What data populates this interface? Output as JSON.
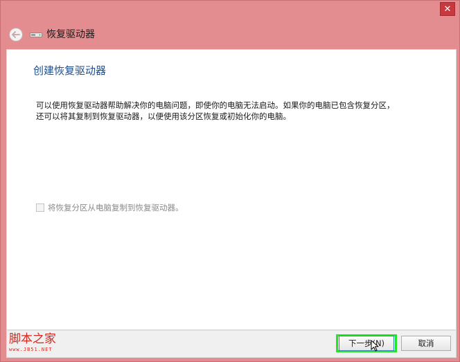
{
  "window": {
    "close_glyph": "✕",
    "title": "恢复驱动器",
    "back_glyph": "⮌"
  },
  "content": {
    "heading": "创建恢复驱动器",
    "body": "可以使用恢复驱动器帮助解决你的电脑问题，即使你的电脑无法启动。如果你的电脑已包含恢复分区，还可以将其复制到恢复驱动器，以便使用该分区恢复或初始化你的电脑。",
    "checkbox": {
      "label": "将恢复分区从电脑复制到恢复驱动器。",
      "checked": false,
      "disabled": true
    }
  },
  "footer": {
    "next_label": "下一步(N)",
    "cancel_label": "取消",
    "highlight_color": "#22e52a"
  },
  "watermark": {
    "text": "脚本之家",
    "sub": "www.JB51.NET"
  },
  "colors": {
    "frame": "#e38d90",
    "heading": "#1e4f8c",
    "watermark": "#d8261f"
  }
}
